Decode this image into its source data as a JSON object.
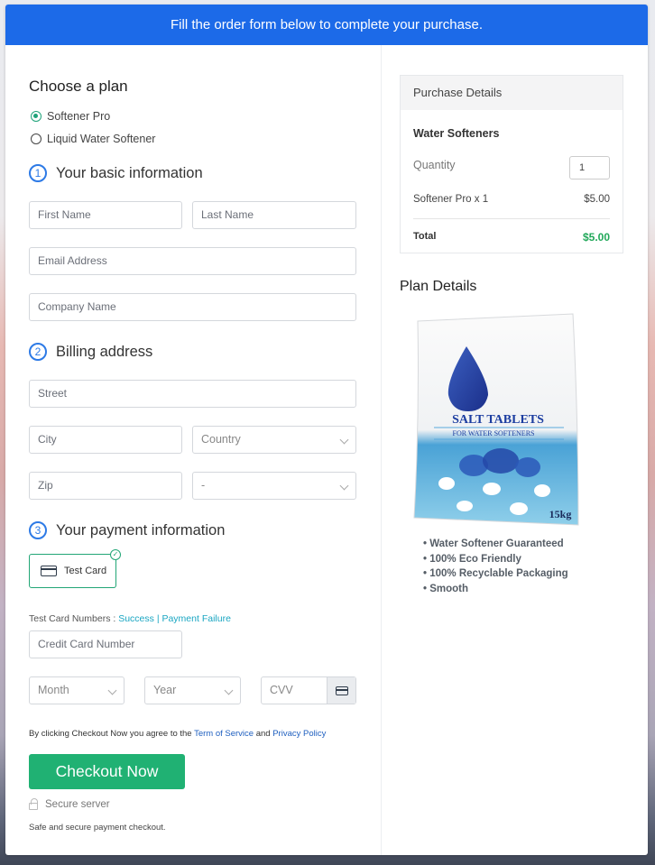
{
  "banner": {
    "text": "Fill the order form below to complete your purchase."
  },
  "plan": {
    "heading": "Choose a plan",
    "options": [
      {
        "label": "Softener Pro",
        "selected": true
      },
      {
        "label": "Liquid Water Softener",
        "selected": false
      }
    ]
  },
  "basic": {
    "number": "1",
    "heading": "Your basic information",
    "first_name": "First Name",
    "last_name": "Last Name",
    "email": "Email Address",
    "company": "Company Name"
  },
  "billing": {
    "number": "2",
    "heading": "Billing address",
    "street": "Street",
    "city": "City",
    "country": "Country",
    "zip": "Zip",
    "state": "-"
  },
  "payment": {
    "number": "3",
    "heading": "Your payment information",
    "method_label": "Test Card",
    "method_selected": true,
    "test_numbers_label": "Test Card Numbers :",
    "success_link": "Success",
    "separator": "|",
    "failure_link": "Payment Failure",
    "card_number": "Credit Card Number",
    "month": "Month",
    "year": "Year",
    "cvv": "CVV"
  },
  "agreement": {
    "prefix": "By clicking Checkout Now you agree to the",
    "terms": "Term of Service",
    "and": "and",
    "privacy": "Privacy Policy"
  },
  "checkout": {
    "button": "Checkout Now",
    "secure": "Secure server",
    "safe": "Safe and secure payment checkout."
  },
  "purchase": {
    "heading": "Purchase Details",
    "product": "Water Softeners",
    "quantity_label": "Quantity",
    "quantity": "1",
    "line_item": "Softener Pro x 1",
    "line_price": "$5.00",
    "total_label": "Total",
    "total": "$5.00"
  },
  "plan_details": {
    "heading": "Plan Details",
    "product_image": {
      "title": "SALT TABLETS",
      "subtitle": "FOR WATER SOFTENERS",
      "weight": "15kg"
    },
    "features": [
      "Water Softener Guaranteed",
      "100% Eco Friendly",
      "100% Recyclable Packaging",
      "Smooth"
    ]
  },
  "colors": {
    "banner": "#1c6ae8",
    "accent_green": "#20b173",
    "step_blue": "#2d7ae6",
    "link_teal": "#1aa6c2",
    "total_green": "#22a85a"
  }
}
